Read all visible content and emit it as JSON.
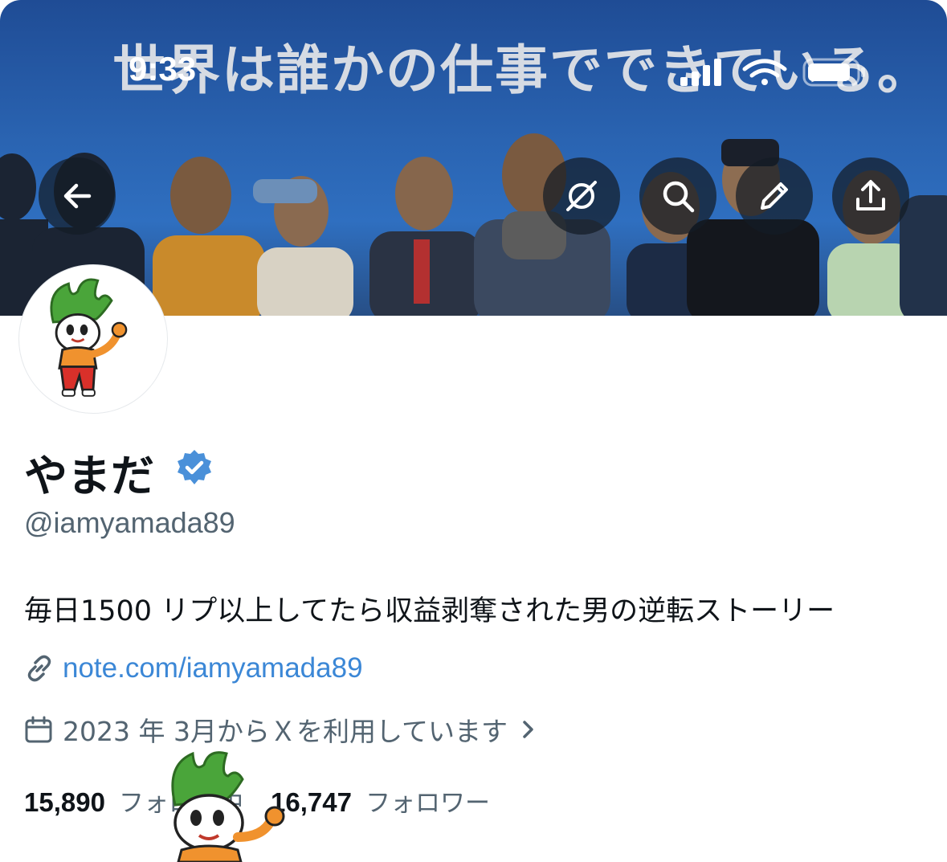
{
  "banner": {
    "tagline": "世界は誰かの仕事でできている。"
  },
  "status_bar": {
    "time": "9:33"
  },
  "profile": {
    "display_name": "やまだ",
    "handle": "@iamyamada89",
    "bio": "毎日1500 リプ以上してたら収益剥奪された男の逆転ストーリー",
    "link": "note.com/iamyamada89",
    "joined": "2023 年 3月からＸを利用しています",
    "following_count": "15,890",
    "following_label": "フォロー中",
    "followers_count": "16,747",
    "followers_label": "フォロワー"
  },
  "colors": {
    "verified": "#4a90d9",
    "link": "#3b87d6",
    "secondary_text": "#536471",
    "banner_blue": "#2a64b2"
  },
  "icons": [
    "back-icon",
    "grok-icon",
    "search-icon",
    "edit-icon",
    "share-icon",
    "verified-icon",
    "link-icon",
    "calendar-icon",
    "chevron-right-icon"
  ]
}
